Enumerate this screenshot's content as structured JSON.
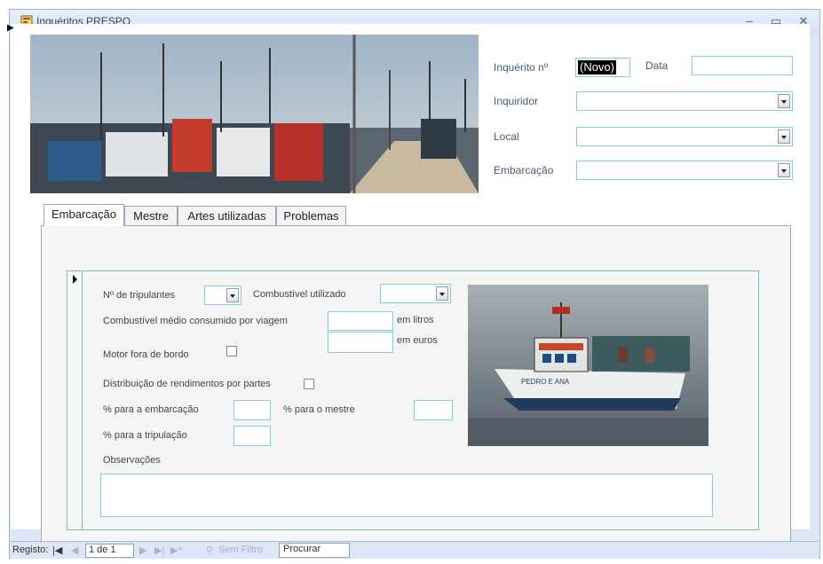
{
  "window": {
    "title": "Inquéritos PRESPO",
    "min_icon": "minimize-icon",
    "max_icon": "maximize-icon",
    "close_icon": "close-icon"
  },
  "header": {
    "inquerito_label": "Inquérito nº",
    "inquerito_value": "(Novo)",
    "data_label": "Data",
    "data_value": "",
    "inquiridor_label": "Inquiridor",
    "inquiridor_value": "",
    "local_label": "Local",
    "local_value": "",
    "embarcacao_label": "Embarcação",
    "embarcacao_value": ""
  },
  "tabs": [
    {
      "label": "Embarcação",
      "active": true
    },
    {
      "label": "Mestre",
      "active": false
    },
    {
      "label": "Artes utilizadas",
      "active": false
    },
    {
      "label": "Problemas",
      "active": false
    }
  ],
  "form": {
    "tripulantes_label": "Nº de tripulantes",
    "tripulantes_value": "",
    "combustivel_label": "Combustível utilizado",
    "combustivel_value": "",
    "consumo_label": "Combustível médio consumido por viagem",
    "em_litros": "em litros",
    "em_euros": "em euros",
    "litros_value": "",
    "euros_value": "",
    "motor_label": "Motor fora de bordo",
    "motor_checked": false,
    "distribuicao_label": "Distribuição de rendimentos por partes",
    "distribuicao_checked": false,
    "pct_embarcacao_label": "% para a embarcação",
    "pct_embarcacao_value": "",
    "pct_mestre_label": "% para o mestre",
    "pct_mestre_value": "",
    "pct_tripulacao_label": "% para a tripulação",
    "pct_tripulacao_value": "",
    "observacoes_label": "Observações",
    "observacoes_value": ""
  },
  "boat_name": "PEDRO E ANA",
  "statusbar": {
    "registo_label": "Registo:",
    "record_value": "1 de 1",
    "filter_label": "Sem Filtro",
    "search_label": "Procurar",
    "filter_icon": "filter-icon"
  },
  "colors": {
    "accent_border": "#7fd0dd",
    "window_bg": "#dce6f4",
    "disabled_text": "#a8b4c4"
  }
}
